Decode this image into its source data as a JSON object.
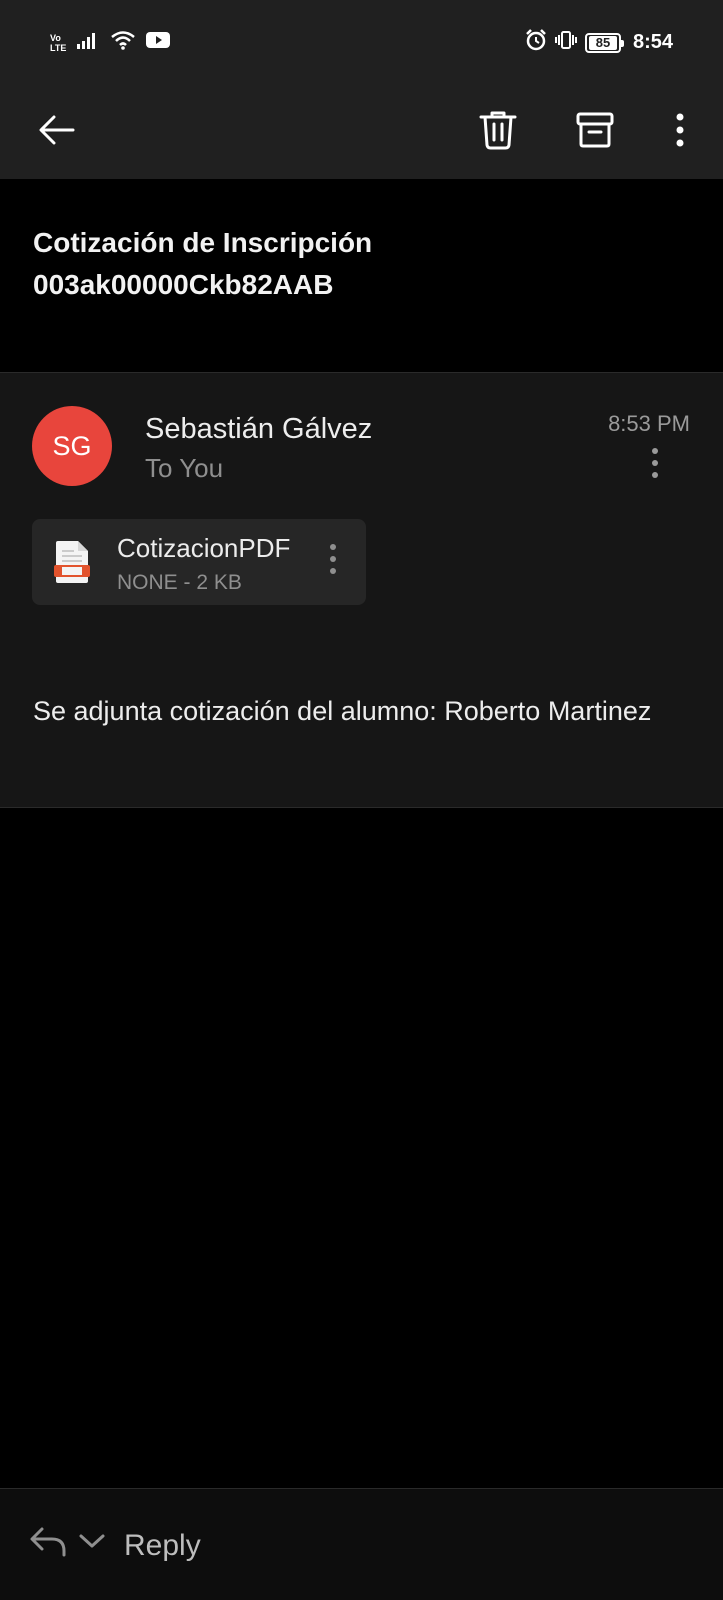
{
  "status_bar": {
    "network_top": "Vo",
    "network_bottom": "LTE",
    "battery": "85",
    "time": "8:54",
    "icons": [
      "signal-icon",
      "wifi-icon",
      "youtube-icon",
      "alarm-icon",
      "vibrate-icon",
      "battery-icon"
    ]
  },
  "toolbar": {
    "icons": [
      "back-arrow-icon",
      "trash-icon",
      "archive-icon",
      "more-vertical-icon"
    ]
  },
  "email": {
    "subject": "Cotización de Inscripción 003ak00000Ckb82AAB",
    "sender_initials": "SG",
    "sender_name": "Sebastián Gálvez",
    "recipient": "To You",
    "time": "8:53 PM",
    "attachment": {
      "name": "CotizacionPDF",
      "meta": "NONE - 2 KB"
    },
    "body": "Se adjunta cotización del alumno: Roberto Martinez"
  },
  "reply": {
    "label": "Reply"
  },
  "colors": {
    "avatar": "#e8453c",
    "status_bar_bg": "#202020",
    "card_bg": "#161616"
  }
}
